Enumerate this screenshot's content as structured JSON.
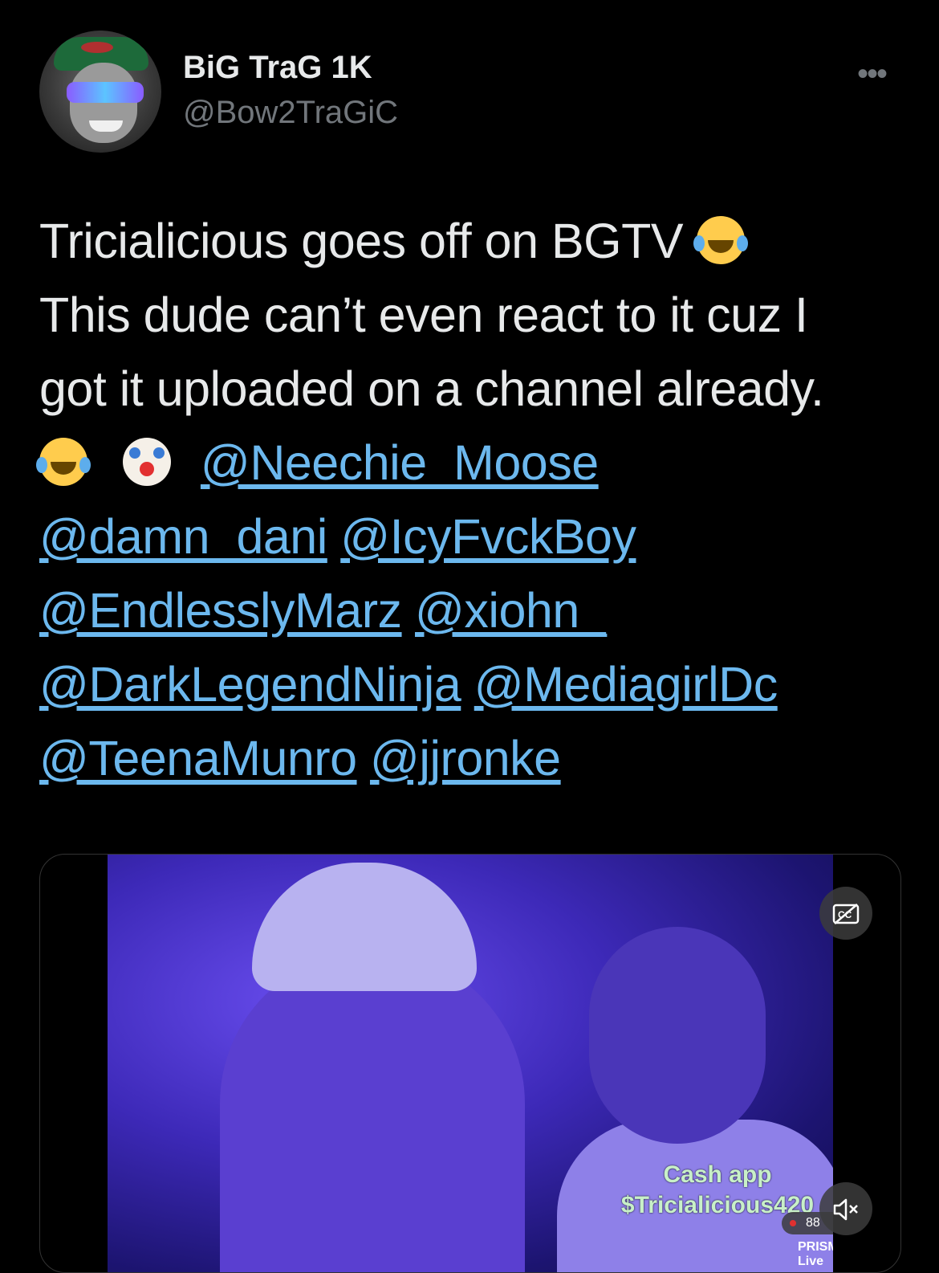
{
  "author": {
    "display_name": "BiG TraG 1K",
    "handle": "@Bow2TraGiC"
  },
  "more_label": "•••",
  "tweet": {
    "line1_text": "Tricialicious goes off on BGTV",
    "line1_emoji": "face-with-tears-of-joy",
    "line2_text": "This dude can’t even react to it cuz I",
    "line3_text": "got it uploaded on a channel already.",
    "line4_emojis": [
      "face-with-tears-of-joy",
      "clown-face"
    ],
    "mentions": [
      "@Neechie_Moose",
      "@damn_dani",
      "@IcyFvckBoy",
      "@EndlesslyMarz",
      "@xiohn_",
      "@DarkLegendNinja",
      "@MediagirlDc",
      "@TeenaMunro",
      "@jjronke"
    ]
  },
  "media": {
    "overlay_line1": "Cash app",
    "overlay_line2": "$Tricialicious420",
    "viewer_count": "88",
    "watermark": "PRISM Live",
    "cc_icon": "closed-captions-off-icon",
    "mute_icon": "volume-muted-icon"
  }
}
